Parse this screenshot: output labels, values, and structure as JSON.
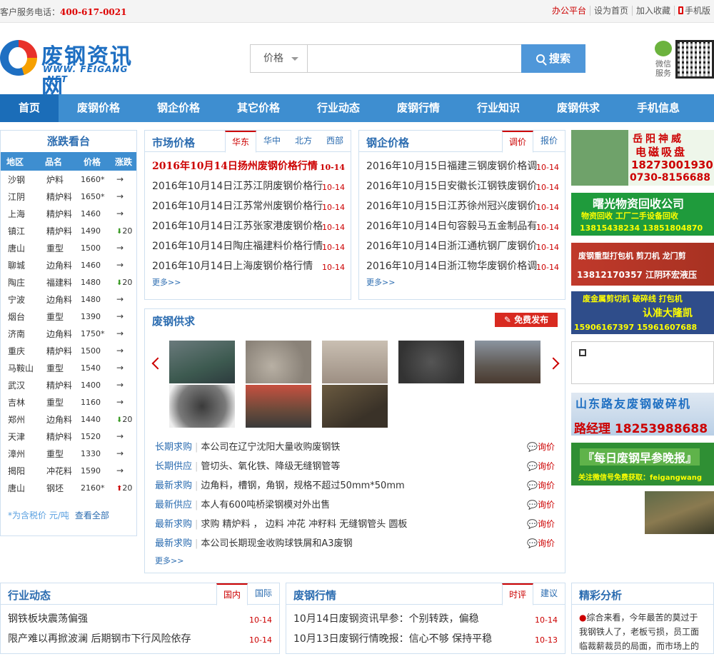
{
  "topbar": {
    "hotline_label": "客户服务电话：",
    "hotline": "400-617-0021",
    "links": [
      "办公平台",
      "设为首页",
      "加入收藏",
      "手机版"
    ]
  },
  "logo": {
    "cn": "废钢资讯网",
    "en": "WWW. FEIGANG .NET"
  },
  "search": {
    "select": "价格",
    "placeholder": "",
    "button": "搜索"
  },
  "wechat": "微信服务",
  "nav": [
    "首页",
    "废钢价格",
    "钢企价格",
    "其它价格",
    "行业动态",
    "废钢行情",
    "行业知识",
    "废钢供求",
    "手机信息"
  ],
  "zhang": {
    "title": "涨跌看台",
    "headers": [
      "地区",
      "品名",
      "价格",
      "涨跌"
    ],
    "rows": [
      [
        "沙钢",
        "炉料",
        "1660*",
        "→"
      ],
      [
        "江阴",
        "精炉料",
        "1650*",
        "→"
      ],
      [
        "上海",
        "精炉料",
        "1460",
        "→"
      ],
      [
        "镇江",
        "精炉料",
        "1490",
        "20"
      ],
      [
        "唐山",
        "重型",
        "1500",
        "→"
      ],
      [
        "聊城",
        "边角料",
        "1460",
        "→"
      ],
      [
        "陶庄",
        "福建料",
        "1480",
        "20"
      ],
      [
        "宁波",
        "边角料",
        "1480",
        "→"
      ],
      [
        "烟台",
        "重型",
        "1390",
        "→"
      ],
      [
        "济南",
        "边角料",
        "1750*",
        "→"
      ],
      [
        "重庆",
        "精炉料",
        "1500",
        "→"
      ],
      [
        "马鞍山",
        "重型",
        "1540",
        "→"
      ],
      [
        "武汉",
        "精炉料",
        "1400",
        "→"
      ],
      [
        "吉林",
        "重型",
        "1160",
        "→"
      ],
      [
        "郑州",
        "边角料",
        "1440",
        "20"
      ],
      [
        "天津",
        "精炉料",
        "1520",
        "→"
      ],
      [
        "漳州",
        "重型",
        "1330",
        "→"
      ],
      [
        "揭阳",
        "冲花料",
        "1590",
        "→"
      ],
      [
        "唐山",
        "钢坯",
        "2160*",
        "20"
      ]
    ],
    "trend": [
      "",
      "",
      "",
      "dn",
      "",
      "",
      "dn",
      "",
      "",
      "",
      "",
      "",
      "",
      "",
      "dn",
      "",
      "",
      "",
      "up"
    ],
    "foot1": "*为含税价 元/吨",
    "foot2": "查看全部"
  },
  "market": {
    "title": "市场价格",
    "tabs": [
      "华东",
      "华中",
      "北方",
      "西部"
    ],
    "items": [
      [
        "2016年10月14日扬州废钢价格行情",
        "10-14"
      ],
      [
        "2016年10月14日江苏江阴废钢价格行",
        "10-14"
      ],
      [
        "2016年10月14日江苏常州废钢价格行",
        "10-14"
      ],
      [
        "2016年10月14日江苏张家港废钢价格",
        "10-14"
      ],
      [
        "2016年10月14日陶庄福建料价格行情",
        "10-14"
      ],
      [
        "2016年10月14日上海废钢价格行情",
        "10-14"
      ]
    ],
    "more": "更多>>"
  },
  "steel": {
    "title": "钢企价格",
    "tabs": [
      "调价",
      "报价"
    ],
    "items": [
      [
        "2016年10月15日福建三钢废钢价格调",
        "10-14"
      ],
      [
        "2016年10月15日安徽长江钢铁废钢价",
        "10-14"
      ],
      [
        "2016年10月15日江苏徐州冠兴废钢价",
        "10-14"
      ],
      [
        "2016年10月14日句容毅马五金制品有",
        "10-14"
      ],
      [
        "2016年10月14日浙江通杭钢厂废钢价",
        "10-14"
      ],
      [
        "2016年10月14日浙江物华废钢价格调",
        "10-14"
      ]
    ],
    "more": "更多>>"
  },
  "supply": {
    "title": "废钢供求",
    "publish": "免费发布",
    "items": [
      [
        "长期求购",
        "本公司在辽宁沈阳大量收购废钢铁"
      ],
      [
        "长期供应",
        "管切头、氧化铁、降级无缝钢管等"
      ],
      [
        "最新求购",
        "边角料，槽钢，角钢，规格不超过50mm*50mm"
      ],
      [
        "最新供应",
        "本人有600吨桥梁钢模对外出售"
      ],
      [
        "最新求购",
        "求购 精炉料 ， 边料 冲花 冲籽料 无缝钢管头 圆板"
      ],
      [
        "最新求购",
        "本公司长期现金收购球铁屑和A3废钢"
      ]
    ],
    "ask": "询价",
    "more": "更多>>"
  },
  "ads": [
    {
      "l1": "岳阳神威",
      "l2": "电磁吸盘",
      "l3": "18273001930",
      "l4": "0730-8156688"
    },
    {
      "l1": "曙光物资回收公司",
      "l2": "物资回收 工厂二手设备回收",
      "l3": "13815438234 13851804870"
    },
    {
      "l1": "废钢重型打包机 剪刀机 龙门剪",
      "l3": "13812170357 江阴环宏液压"
    },
    {
      "l1": "废金属剪切机 破碎线 打包机",
      "l2": "认准大隆凯",
      "l3": "15906167397 15961607688"
    },
    {
      "l1": "山东路友废钢破碎机",
      "l3": "路经理 18253988688"
    },
    {
      "l1": "『每日废钢早参晚报』",
      "l2": "关注微信号免费获取：feigangwang"
    }
  ],
  "industry": {
    "title": "行业动态",
    "tabs": [
      "国内",
      "国际"
    ],
    "items": [
      [
        "钢铁板块震荡偏强",
        "10-14"
      ],
      [
        "限产难以再掀波澜 后期钢市下行风险依存",
        "10-14"
      ]
    ]
  },
  "hq": {
    "title": "废钢行情",
    "tabs": [
      "时评",
      "建议"
    ],
    "items": [
      [
        "10月14日废钢资讯早参：个别转跌，偏稳",
        "10-14"
      ],
      [
        "10月13日废钢行情晚报：信心不够 保持平稳",
        "10-13"
      ]
    ]
  },
  "analysis": {
    "title": "精彩分析",
    "text": "综合来看，今年最苦的莫过于我钢铁人了，老板亏损，员工面临裁薪裁员的局面，而市场上的"
  }
}
